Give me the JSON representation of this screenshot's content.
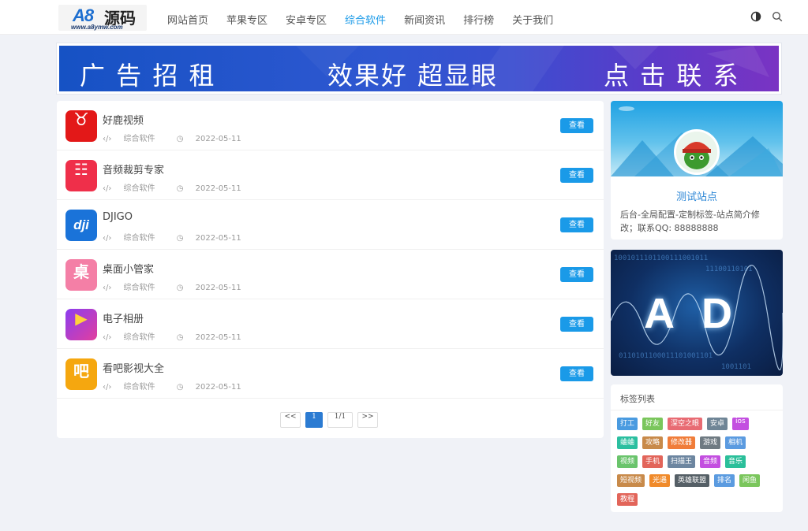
{
  "header": {
    "logo_mark": "A8",
    "logo_text": "源码",
    "logo_url": "www.a8ymw.com",
    "nav": [
      "网站首页",
      "苹果专区",
      "安卓专区",
      "综合软件",
      "新闻资讯",
      "排行榜",
      "关于我们"
    ],
    "active_nav": "综合软件",
    "icons": [
      "theme-toggle-icon",
      "search-icon"
    ]
  },
  "banner": {
    "left": "广 告 招 租",
    "middle": "效果好 超显眼",
    "right": "点 击 联 系"
  },
  "apps": [
    {
      "name": "好鹿视频",
      "category": "综合软件",
      "date": "2022-05-11",
      "button": "查看",
      "icon": "deer-video-icon",
      "icon_char": "♉",
      "icon_color": "#e31818"
    },
    {
      "name": "音频裁剪专家",
      "category": "综合软件",
      "date": "2022-05-11",
      "button": "查看",
      "icon": "audio-cut-icon",
      "icon_char": "☷",
      "icon_color": "#ef2f4a"
    },
    {
      "name": "DJIGO",
      "category": "综合软件",
      "date": "2022-05-11",
      "button": "查看",
      "icon": "dji-icon",
      "icon_char": "dji",
      "icon_color": "#1a73d9"
    },
    {
      "name": "桌面小管家",
      "category": "综合软件",
      "date": "2022-05-11",
      "button": "查看",
      "icon": "desktop-manager-icon",
      "icon_char": "桌",
      "icon_color": "#f47fa6"
    },
    {
      "name": "电子相册",
      "category": "综合软件",
      "date": "2022-05-11",
      "button": "查看",
      "icon": "photo-album-icon",
      "icon_char": "▶",
      "icon_color": "#b03ad8"
    },
    {
      "name": "看吧影视大全",
      "category": "综合软件",
      "date": "2022-05-11",
      "button": "查看",
      "icon": "kanba-icon",
      "icon_char": "吧",
      "icon_color": "#f5a70f"
    }
  ],
  "pager": {
    "prev": "<<",
    "current": "1",
    "total": "1/1",
    "next": ">>"
  },
  "profile": {
    "name": "测试站点",
    "desc": "后台-全局配置-定制标签-站点简介修改；联系QQ: 88888888"
  },
  "ad": {
    "text": "AD"
  },
  "tags": {
    "title": "标签列表",
    "items": [
      {
        "label": "打工",
        "color": "#4a9be0"
      },
      {
        "label": "好友",
        "color": "#7ac65c"
      },
      {
        "label": "深空之眼",
        "color": "#e86b73"
      },
      {
        "label": "安卓",
        "color": "#6f8596"
      },
      {
        "label": "ios",
        "color": "#c34fe0"
      },
      {
        "label": "蛐蛐",
        "color": "#2bbfa0"
      },
      {
        "label": "攻略",
        "color": "#c88a4a"
      },
      {
        "label": "修改器",
        "color": "#f07d3a"
      },
      {
        "label": "游戏",
        "color": "#6f7a82"
      },
      {
        "label": "相机",
        "color": "#5b9be0"
      },
      {
        "label": "视频",
        "color": "#6ac46c"
      },
      {
        "label": "手机",
        "color": "#e2655a"
      },
      {
        "label": "扫描王",
        "color": "#6d86a0"
      },
      {
        "label": "音频",
        "color": "#c34fe0"
      },
      {
        "label": "音乐",
        "color": "#2bbf9a"
      },
      {
        "label": "短视频",
        "color": "#c88a4a"
      },
      {
        "label": "光遇",
        "color": "#f08a2a"
      },
      {
        "label": "英雄联盟",
        "color": "#555f66"
      },
      {
        "label": "排名",
        "color": "#5b9be0"
      },
      {
        "label": "闲鱼",
        "color": "#7ac65c"
      },
      {
        "label": "教程",
        "color": "#e2655a"
      }
    ]
  }
}
